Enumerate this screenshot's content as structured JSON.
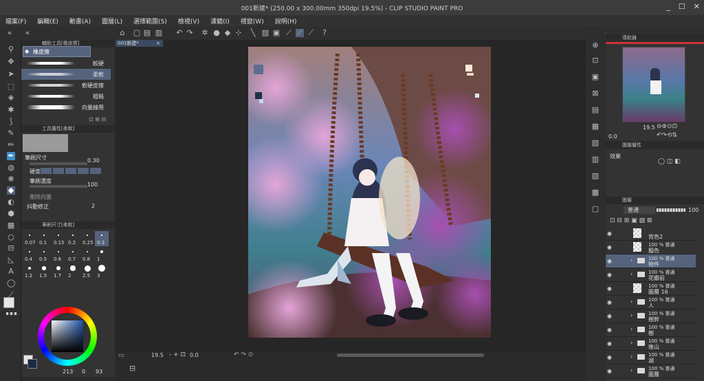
{
  "window": {
    "title": "001新建* (250.00 x 300.00mm 350dpi 19.5%) - CLIP STUDIO PAINT PRO",
    "minimize": "_",
    "maximize": "☐",
    "close": "✕"
  },
  "menu": [
    "檔案(F)",
    "編輯(E)",
    "動畫(A)",
    "圖層(L)",
    "選擇範圍(S)",
    "檢視(V)",
    "濾鏡(I)",
    "視窗(W)",
    "說明(H)"
  ],
  "subtool": {
    "panel_title": "輔助工具[橡皮擦]",
    "group": "橡皮擦",
    "brushes": [
      {
        "label": "較硬"
      },
      {
        "label": "柔軟"
      },
      {
        "label": "軟硬皮擦"
      },
      {
        "label": "粗糙"
      },
      {
        "label": "向量線用"
      }
    ],
    "selected_index": 1
  },
  "tool_property": {
    "panel_title": "工具屬性[柔軟]",
    "brush_size_label": "筆刷尺寸",
    "brush_size_value": "0.30",
    "hardness_label": "硬度",
    "density_label": "筆刷濃度",
    "density_value": "100",
    "erase_vector_label": "刪除向量",
    "stabilization_label": "抖動修正",
    "stabilization_value": "2"
  },
  "brush_size_panel": {
    "panel_title": "筆刷尺寸[柔軟]",
    "sizes": [
      "0.07",
      "0.1",
      "0.15",
      "0.2",
      "0.25",
      "0.3",
      "0.4",
      "0.5",
      "0.6",
      "0.7",
      "0.8",
      "1",
      "1.2",
      "1.5",
      "1.7",
      "2",
      "2.5",
      "3"
    ],
    "selected": "0.3"
  },
  "color": {
    "hex_readout": "213",
    "value_readout": "0",
    "extra_readout": "93",
    "main": "#e6e6e6",
    "sub": "#1a2a44"
  },
  "document": {
    "tab": "001新建*"
  },
  "canvas_status": {
    "zoom": "19.5",
    "rotation": "0.0"
  },
  "navigator": {
    "panel_title": "導航器",
    "zoom": "19.5",
    "rotation": "0.0"
  },
  "property": {
    "panel_title": "圖層屬性",
    "effect_label": "效果"
  },
  "layer": {
    "panel_title": "圖層",
    "blend_mode": "普通",
    "opacity": "100",
    "rows": [
      {
        "l1": "",
        "l2": "背色2",
        "type": "layer"
      },
      {
        "l1": "100 % 普通",
        "l2": "擬色",
        "type": "layer"
      },
      {
        "l1": "100 % 普通",
        "l2": "物件",
        "type": "folder",
        "selected": true
      },
      {
        "l1": "100 % 普通",
        "l2": "花瓣前",
        "type": "folder"
      },
      {
        "l1": "100 % 普通",
        "l2": "圖層 16",
        "type": "layer"
      },
      {
        "l1": "100 % 普通",
        "l2": "人",
        "type": "folder"
      },
      {
        "l1": "100 % 普通",
        "l2": "樹幹",
        "type": "folder"
      },
      {
        "l1": "100 % 普通",
        "l2": "樹",
        "type": "folder"
      },
      {
        "l1": "100 % 普通",
        "l2": "後山",
        "type": "folder"
      },
      {
        "l1": "100 % 普通",
        "l2": "湖",
        "type": "folder"
      },
      {
        "l1": "100 % 普通",
        "l2": "圖層",
        "type": "folder"
      }
    ]
  },
  "colors": {
    "accent": "#55637d",
    "bg": "#2b2b2b",
    "panel": "#333333"
  }
}
